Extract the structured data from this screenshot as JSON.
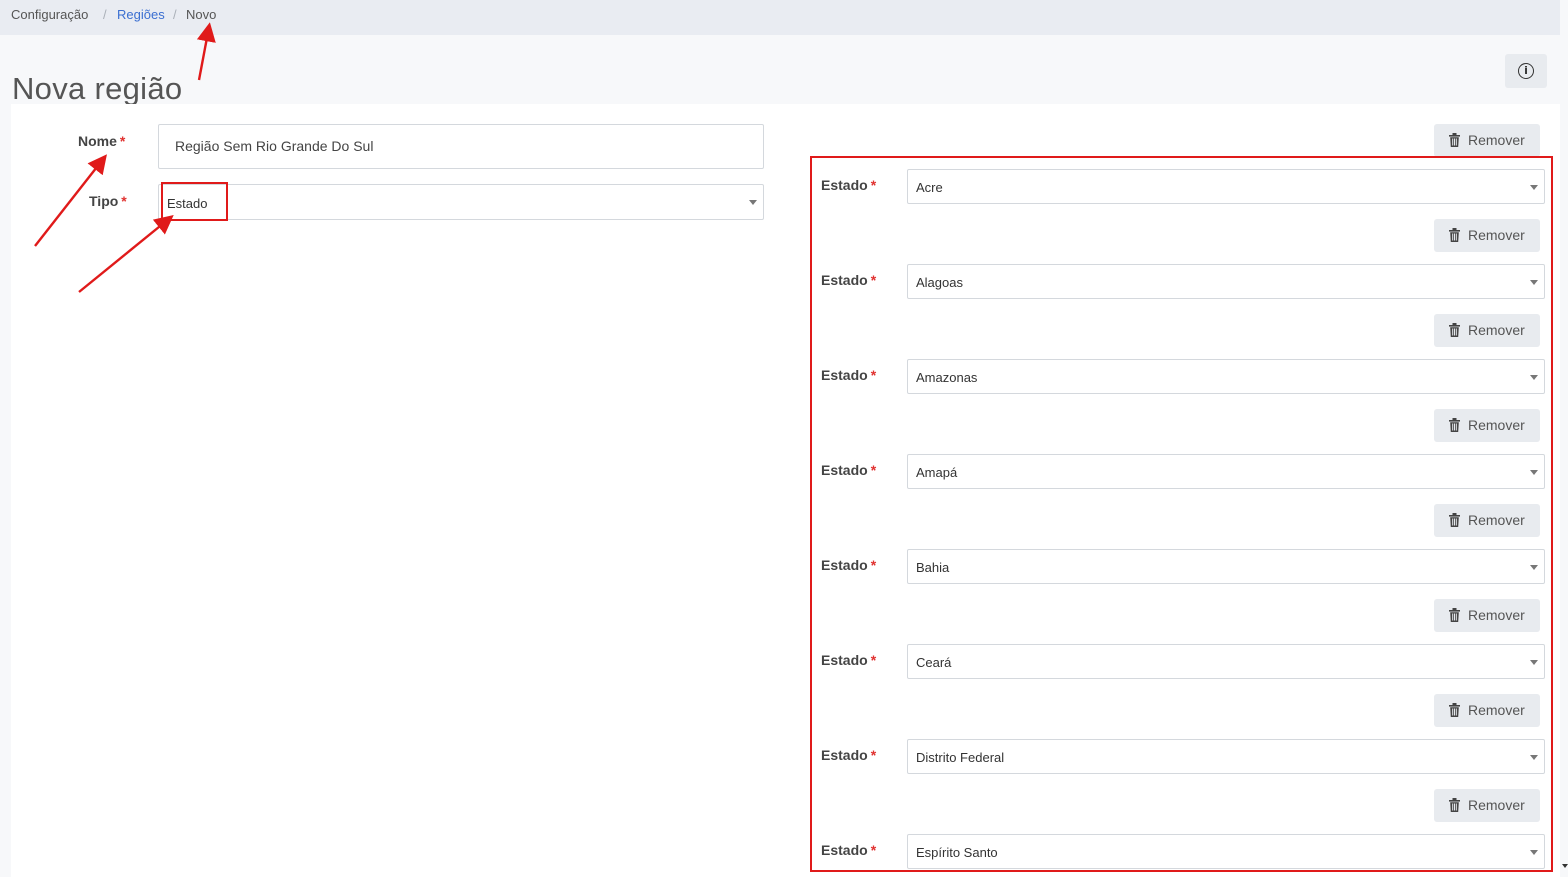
{
  "breadcrumb": {
    "items": [
      "Configuração",
      "Regiões",
      "Novo"
    ],
    "separator": "/"
  },
  "page": {
    "title": "Nova região"
  },
  "form": {
    "nome_label": "Nome",
    "nome_value": "Região Sem Rio Grande Do Sul",
    "tipo_label": "Tipo",
    "tipo_value": "Estado",
    "required_mark": "*"
  },
  "estados": {
    "label": "Estado",
    "remove_label": "Remover",
    "values": [
      "Acre",
      "Alagoas",
      "Amazonas",
      "Amapá",
      "Bahia",
      "Ceará",
      "Distrito Federal",
      "Espírito Santo"
    ]
  },
  "icons": {
    "info": "info-circle-icon",
    "remove": "trash-icon",
    "dropdown": "caret-down-icon"
  },
  "colors": {
    "link": "#3b6fd1",
    "required": "#e0312f",
    "annotation": "#e01a1a"
  }
}
